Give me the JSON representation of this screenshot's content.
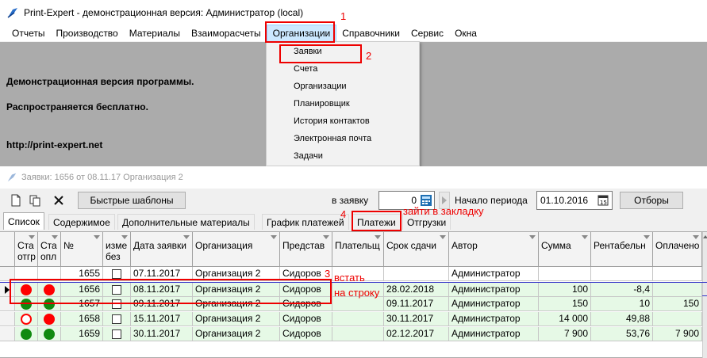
{
  "app": {
    "title": "Print-Expert - демонстрационная версия: Администратор (local)"
  },
  "menu": {
    "items": [
      "Отчеты",
      "Производство",
      "Материалы",
      "Взаиморасчеты",
      "Организации",
      "Справочники",
      "Сервис",
      "Окна"
    ],
    "active_index": 4
  },
  "dropdown": {
    "items": [
      "Заявки",
      "Счета",
      "Организации",
      "Планировщик",
      "История контактов",
      "Электронная почта",
      "Задачи"
    ]
  },
  "background": {
    "demo_line": "Демонстрационная версия программы.",
    "free_line": "Распространяется бесплатно.",
    "url": "http://print-expert.net"
  },
  "child_window": {
    "title": "Заявки: 1656 от 08.11.17  Организация 2"
  },
  "toolbar": {
    "quick_templates": "Быстрые шаблоны",
    "to_request_label": "в заявку",
    "to_request_value": "0",
    "period_start_label": "Начало периода",
    "period_start_value": "01.10.2016",
    "filters": "Отборы"
  },
  "tabs": [
    "Список",
    "Содержимое",
    "Дополнительные материалы",
    "График платежей",
    "Платежи",
    "Отгрузки"
  ],
  "table": {
    "headers": [
      "Ста отгр",
      "Ста опл",
      "№",
      "изме без",
      "Дата заявки",
      "Организация",
      "Представ",
      "Плательщ",
      "Срок сдачи",
      "Автор",
      "Сумма",
      "Рентабельн",
      "Оплачено"
    ],
    "rows": [
      {
        "ship": "",
        "pay": "",
        "num": "1655",
        "date": "07.11.2017",
        "org": "Организация 2",
        "rep": "Сидоров",
        "payer": "",
        "due": "",
        "author": "Администратор",
        "sum": "",
        "profit": "",
        "paid": ""
      },
      {
        "ship": "red",
        "pay": "red",
        "num": "1656",
        "date": "08.11.2017",
        "org": "Организация 2",
        "rep": "Сидоров",
        "payer": "",
        "due": "28.02.2018",
        "author": "Администратор",
        "sum": "100",
        "profit": "-8,4",
        "paid": ""
      },
      {
        "ship": "green",
        "pay": "green",
        "num": "1657",
        "date": "09.11.2017",
        "org": "Организация 2",
        "rep": "Сидоров",
        "payer": "",
        "due": "09.11.2017",
        "author": "Администратор",
        "sum": "150",
        "profit": "10",
        "paid": "150"
      },
      {
        "ship": "red-ring",
        "pay": "red",
        "num": "1658",
        "date": "15.11.2017",
        "org": "Организация 2",
        "rep": "Сидоров",
        "payer": "",
        "due": "30.11.2017",
        "author": "Администратор",
        "sum": "14 000",
        "profit": "49,88",
        "paid": ""
      },
      {
        "ship": "green",
        "pay": "green",
        "num": "1659",
        "date": "30.11.2017",
        "org": "Организация 2",
        "rep": "Сидоров",
        "payer": "",
        "due": "02.12.2017",
        "author": "Администратор",
        "sum": "7 900",
        "profit": "53,76",
        "paid": "7 900"
      }
    ]
  },
  "annotations": {
    "step1": "1",
    "step2": "2",
    "step3": "3",
    "step4": "4",
    "stand_on": "встать",
    "on_row": "на строку",
    "go_to_tab": "зайти в закладку"
  },
  "colors": {
    "highlight_row": "#e6f9e6",
    "status_red": "#ff0000",
    "status_green": "#108a10",
    "annotation": "#e00000",
    "menu_active": "#cce8ff"
  }
}
